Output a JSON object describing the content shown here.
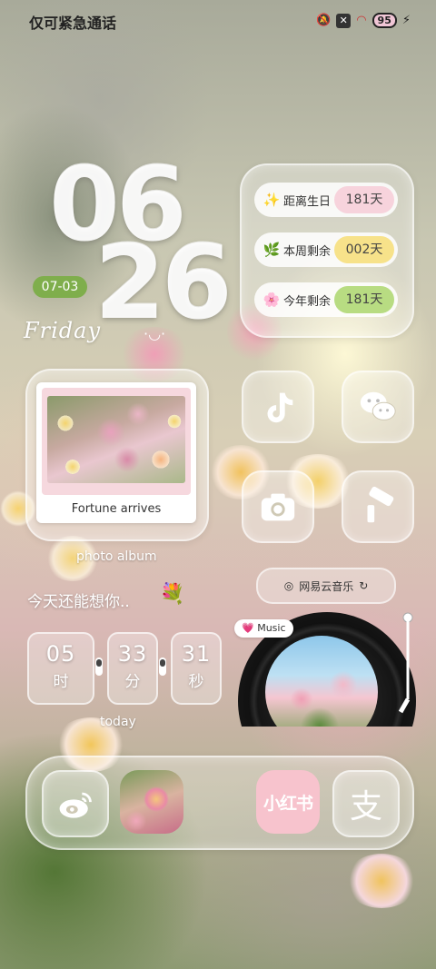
{
  "status_bar": {
    "left_text": "仅可紧急通话",
    "battery": "95"
  },
  "clock": {
    "hour": "06",
    "minute": "26",
    "date": "07-03",
    "weekday": "Friday"
  },
  "countdown": [
    {
      "emoji": "✨",
      "label": "距离生日",
      "value": "181天",
      "color": "#f7d3dc"
    },
    {
      "emoji": "🌿",
      "label": "本周剩余",
      "value": "002天",
      "color": "#f7e28a"
    },
    {
      "emoji": "🌸",
      "label": "今年剩余",
      "value": "181天",
      "color": "#b8dc82"
    }
  ],
  "photo_widget": {
    "caption": "Fortune arrives",
    "label": "photo album"
  },
  "apps": {
    "tiktok": "tiktok-icon",
    "wechat": "wechat-icon",
    "camera": "camera-icon",
    "theme": "paint-roller-icon"
  },
  "music": {
    "app_name": "网易云音乐",
    "tag": "Music"
  },
  "thought": "今天还能想你..",
  "timer": {
    "hours": "05",
    "hours_unit": "时",
    "minutes": "33",
    "minutes_unit": "分",
    "seconds": "31",
    "seconds_unit": "秒",
    "label": "today"
  },
  "dock": {
    "weibo": "weibo-icon",
    "xiaohongshu": "小红书",
    "alipay": "支"
  }
}
